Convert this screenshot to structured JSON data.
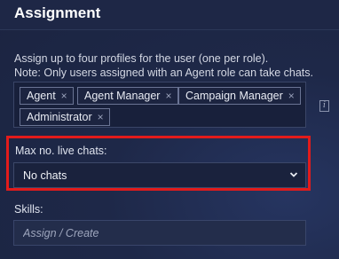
{
  "section": {
    "title": "Assignment"
  },
  "description": {
    "line1": "Assign up to four profiles for the user (one per role).",
    "line2": "Note: Only users assigned with an Agent role can take chats."
  },
  "profiles": {
    "tags": [
      {
        "label": "Agent"
      },
      {
        "label": "Agent Manager"
      },
      {
        "label": "Campaign Manager"
      },
      {
        "label": "Administrator"
      }
    ],
    "remove_glyph": "×",
    "info_glyph": "i"
  },
  "max_live_chats": {
    "label": "Max no. live chats:",
    "selected": "No chats",
    "highlight_color": "#e21b1b"
  },
  "skills": {
    "label": "Skills:",
    "placeholder": "Assign / Create"
  }
}
